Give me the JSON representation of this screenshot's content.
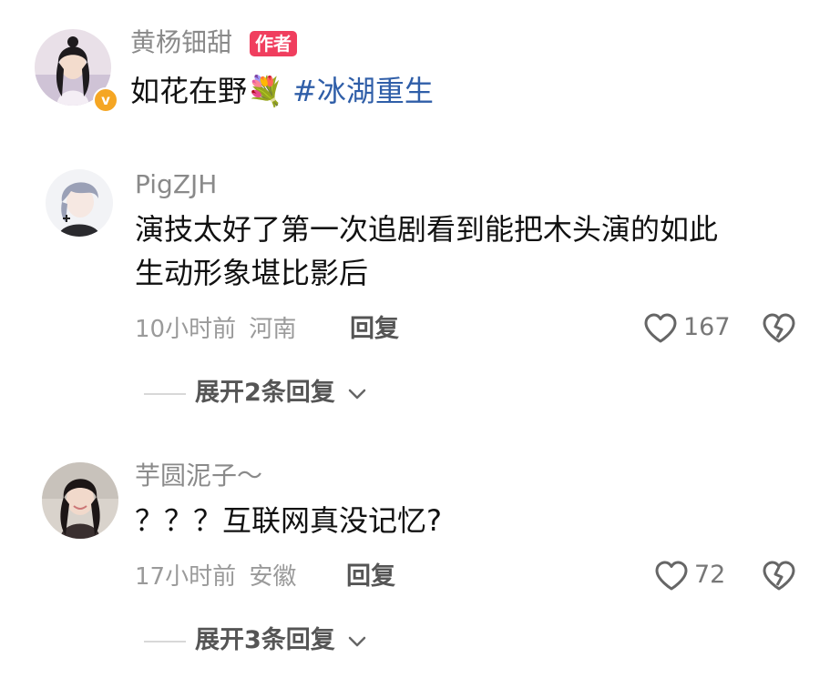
{
  "author_comment": {
    "username": "黄杨钿甜",
    "badge": "作者",
    "text": "如花在野",
    "emoji": "💐",
    "hashtag": "#冰湖重生",
    "verified_mark": "v"
  },
  "comments": [
    {
      "username": "PigZJH",
      "text_line1": "演技太好了第一次追剧看到能把木头演的如此",
      "text_line2": "生动形象堪比影后",
      "time": "10小时前",
      "location": "河南",
      "reply_label": "回复",
      "likes": "167",
      "expand_label": "展开2条回复"
    },
    {
      "username": "芋圆泥子～",
      "text_line1": "？？？互联网真没记忆?",
      "time": "17小时前",
      "location": "安徽",
      "reply_label": "回复",
      "likes": "72",
      "expand_label": "展开3条回复"
    }
  ],
  "icons": {
    "like": "heart-outline-icon",
    "dislike": "broken-heart-icon",
    "expand": "chevron-down-icon"
  },
  "colors": {
    "badge": "#f03e5e",
    "hashtag": "#2f5ea8",
    "verified": "#f5a623"
  }
}
